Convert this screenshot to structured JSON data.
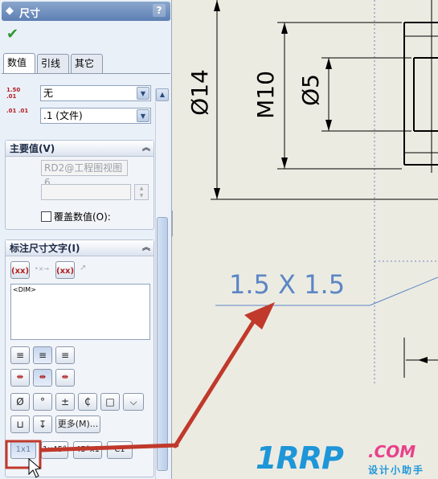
{
  "panel": {
    "title": "尺寸",
    "help": "?",
    "tabs": [
      "数值",
      "引线",
      "其它"
    ],
    "tolerance": {
      "precision_icon_label": "1.50 .01",
      "tolerance_value": "无",
      "precision_icon2_label": ".01 .01",
      "precision_value": ".1 (文件)"
    },
    "primary_value": {
      "header": "主要值(V)",
      "reference": "RD2@工程图视图6",
      "value": "",
      "override_label": "覆盖数值(O):"
    },
    "dim_text": {
      "header": "标注尺寸文字(I)",
      "text": "<DIM>",
      "symbol_buttons": [
        "Ø",
        "°",
        "±",
        "₵",
        "□",
        "⌵"
      ],
      "more_button": "更多(M)...",
      "chamfer_buttons": [
        "1x1",
        "1x45°",
        "45°x1",
        "C1"
      ]
    }
  },
  "drawing": {
    "dimensions": [
      "Ø14",
      "M10",
      "Ø5",
      "1.5 X 1.5"
    ]
  },
  "watermark": {
    "brand": "1RRP",
    "domain": ".COM",
    "tagline": "设计小助手"
  },
  "colors": {
    "annotation_arrow": "#c0392b",
    "highlight_box": "#c0392b",
    "dimension_preview": "#5b86c4",
    "drawing_lines": "#000000"
  }
}
